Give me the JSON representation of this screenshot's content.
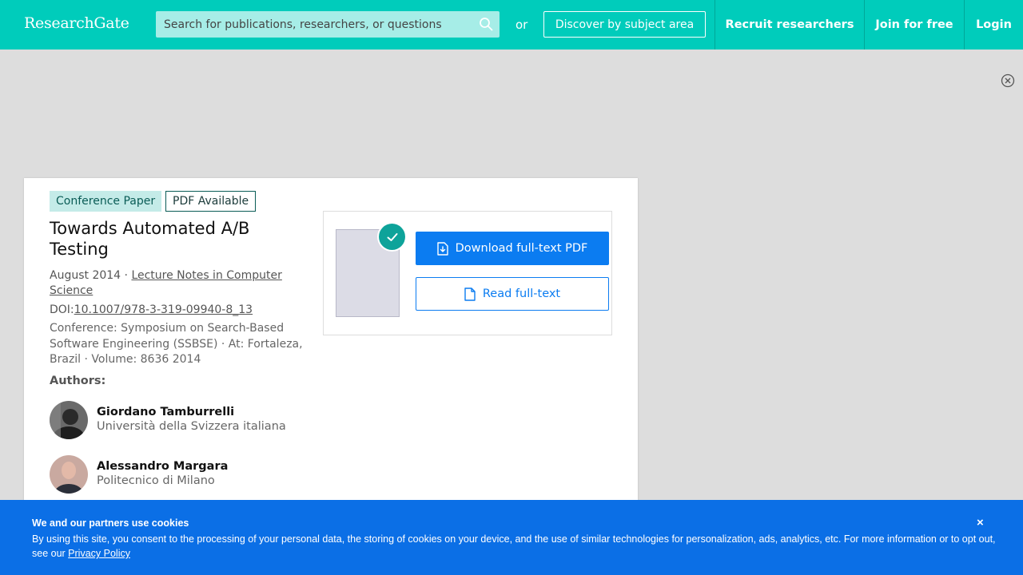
{
  "header": {
    "logo": "ResearchGate",
    "search_placeholder": "Search for publications, researchers, or questions",
    "or_label": "or",
    "discover_label": "Discover by subject area",
    "nav": {
      "recruit": "Recruit researchers",
      "join": "Join for free",
      "login": "Login"
    },
    "brand_color": "#00ccbb"
  },
  "publication": {
    "badges": {
      "type": "Conference Paper",
      "pdf": "PDF Available"
    },
    "title": "Towards Automated A/B Testing",
    "date_prefix": "August 2014 · ",
    "journal": "Lecture Notes in Computer Science",
    "doi_label": "DOI:",
    "doi": "10.1007/978-3-319-09940-8_13",
    "conference": "Conference: Symposium on Search-Based Software Engineering (SSBSE) · At: Fortaleza, Brazil · Volume: 8636 2014",
    "authors_heading": "Authors:",
    "authors": [
      {
        "name": "Giordano Tamburrelli",
        "affiliation": "Università della Svizzera italiana"
      },
      {
        "name": "Alessandro Margara",
        "affiliation": "Politecnico di Milano"
      }
    ],
    "actions": {
      "download": "Download full-text PDF",
      "read": "Read full-text"
    }
  },
  "cookie_banner": {
    "title": "We and our partners use cookies",
    "text": "By using this site, you consent to the processing of your personal data, the storing of cookies on your device, and the use of similar technologies for personalization, ads, analytics, etc. For more information or to opt out, see our ",
    "link": "Privacy Policy",
    "close": "×",
    "color": "#0b6fe6"
  }
}
